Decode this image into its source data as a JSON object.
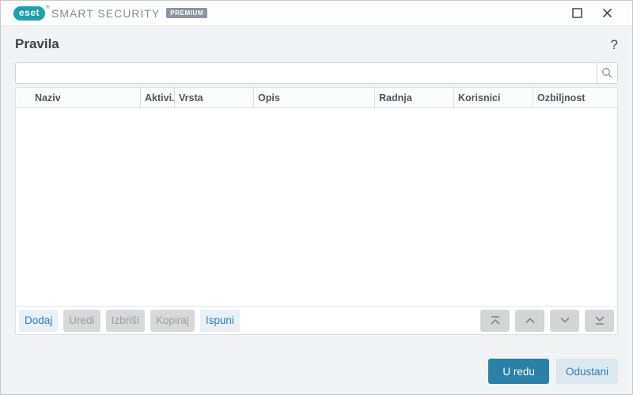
{
  "window": {
    "titlebar": {
      "logo_text": "eset",
      "registered_mark": "®",
      "product_name": "SMART SECURITY",
      "edition_badge": "PREMIUM"
    }
  },
  "page": {
    "title": "Pravila",
    "help_glyph": "?"
  },
  "search": {
    "value": "",
    "placeholder": ""
  },
  "table": {
    "columns": [
      {
        "label": "Naziv"
      },
      {
        "label": "Aktivi..."
      },
      {
        "label": "Vrsta"
      },
      {
        "label": "Opis"
      },
      {
        "label": "Radnja"
      },
      {
        "label": "Korisnici"
      },
      {
        "label": "Ozbiljnost"
      }
    ],
    "rows": []
  },
  "actions": {
    "add": {
      "label": "Dodaj",
      "enabled": true
    },
    "edit": {
      "label": "Uredi",
      "enabled": false
    },
    "delete": {
      "label": "Izbriši",
      "enabled": false
    },
    "copy": {
      "label": "Kopiraj",
      "enabled": false
    },
    "fill": {
      "label": "Ispuni",
      "enabled": true
    },
    "move": {
      "top_enabled": false,
      "up_enabled": false,
      "down_enabled": false,
      "bottom_enabled": false
    }
  },
  "dialog": {
    "ok_label": "U redu",
    "cancel_label": "Odustani"
  },
  "icons": {
    "help": "question-mark",
    "search": "magnifier",
    "maximize": "square-outline",
    "close": "x-mark",
    "move_top": "chevron-up-to-line",
    "move_up": "chevron-up",
    "move_down": "chevron-down",
    "move_bottom": "chevron-down-to-line"
  },
  "colors": {
    "brand_teal": "#1aa2ae",
    "accent_blue": "#2b80b8",
    "primary_button_bg": "#2b80a9",
    "window_bg": "#f1f3f4"
  }
}
